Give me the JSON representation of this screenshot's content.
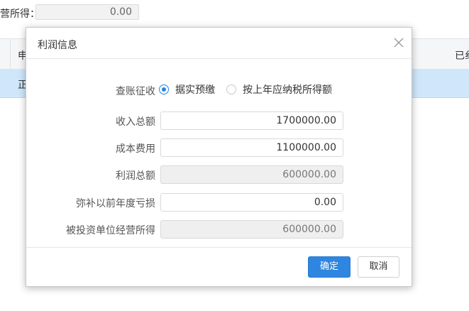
{
  "background": {
    "field_label": "营所得：",
    "field_value": "0.00",
    "table_header_left": "申",
    "table_header_right": "已纟",
    "table_row_left": "正"
  },
  "dialog": {
    "title": "利润信息",
    "close_icon": "close-icon",
    "accent_color": "#1e88e5",
    "collection_method": {
      "label": "查账征收",
      "options": [
        {
          "label": "据实预缴",
          "selected": true
        },
        {
          "label": "按上年应纳税所得额",
          "selected": false
        }
      ]
    },
    "fields": [
      {
        "label": "收入总额",
        "value": "1700000.00",
        "readonly": false
      },
      {
        "label": "成本费用",
        "value": "1100000.00",
        "readonly": false
      },
      {
        "label": "利润总额",
        "value": "600000.00",
        "readonly": true
      },
      {
        "label": "弥补以前年度亏损",
        "value": "0.00",
        "readonly": false
      },
      {
        "label": "被投资单位经营所得",
        "value": "600000.00",
        "readonly": true
      }
    ],
    "buttons": {
      "confirm": "确定",
      "cancel": "取消"
    }
  }
}
